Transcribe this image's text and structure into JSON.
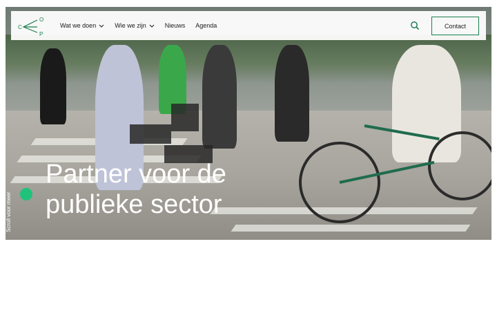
{
  "header": {
    "logo_letters": [
      "C",
      "O",
      "P"
    ],
    "nav": [
      {
        "label": "Wat we doen",
        "dropdown": true
      },
      {
        "label": "Wie we zijn",
        "dropdown": true
      },
      {
        "label": "Nieuws",
        "dropdown": false
      },
      {
        "label": "Agenda",
        "dropdown": false
      }
    ],
    "search_icon": "search-icon",
    "contact_label": "Contact"
  },
  "hero": {
    "headline_line1": "Partner voor de",
    "headline_line2": "publieke sector",
    "scroll_label": "Scroll voor meer"
  },
  "colors": {
    "accent": "#1fc27b",
    "button_border": "#1a7d50"
  }
}
